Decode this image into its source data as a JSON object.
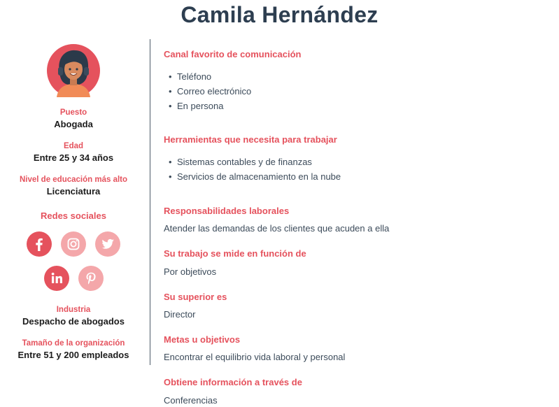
{
  "title": "Camila Hernández",
  "profile": {
    "puesto_label": "Puesto",
    "puesto_value": "Abogada",
    "edad_label": "Edad",
    "edad_value": "Entre 25 y 34 años",
    "educacion_label": "Nivel de educación más alto",
    "educacion_value": "Licenciatura",
    "redes_label": "Redes sociales",
    "industria_label": "Industria",
    "industria_value": "Despacho de abogados",
    "tamano_label": "Tamaño de la organización",
    "tamano_value": "Entre 51 y 200 empleados"
  },
  "social": {
    "icons": [
      "facebook-icon",
      "instagram-icon",
      "twitter-icon",
      "linkedin-icon",
      "pinterest-icon"
    ]
  },
  "sections": {
    "canal_title": "Canal favorito de comunicación",
    "canal_items": [
      "Teléfono",
      "Correo electrónico",
      "En persona"
    ],
    "herramientas_title": "Herramientas que necesita para trabajar",
    "herramientas_items": [
      "Sistemas contables y de finanzas",
      "Servicios de almacenamiento en la nube"
    ],
    "responsabilidades_title": "Responsabilidades laborales",
    "responsabilidades_text": "Atender las demandas de los clientes que acuden a ella",
    "medicion_title": "Su trabajo se mide en función de",
    "medicion_text": "Por objetivos",
    "superior_title": "Su superior es",
    "superior_text": "Director",
    "metas_title": "Metas u objetivos",
    "metas_text": "Encontrar el equilibrio vida laboral y personal",
    "informacion_title": "Obtiene información a través de",
    "informacion_text": "Conferencias"
  },
  "colors": {
    "accent": "#e5525d",
    "accent_light": "#f4a7aa",
    "title": "#2d3e50",
    "text": "#3c4b5a"
  }
}
